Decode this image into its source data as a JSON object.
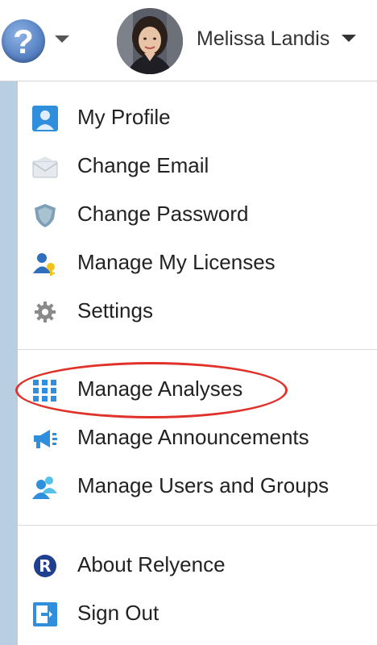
{
  "header": {
    "help_icon": "help-question-icon",
    "help_symbol": "?",
    "user_name": "Melissa Landis"
  },
  "menu": {
    "items": [
      {
        "label": "My Profile",
        "icon": "profile-icon"
      },
      {
        "label": "Change Email",
        "icon": "envelope-icon"
      },
      {
        "label": "Change Password",
        "icon": "shield-icon"
      },
      {
        "label": "Manage My Licenses",
        "icon": "user-key-icon"
      },
      {
        "label": "Settings",
        "icon": "gear-icon"
      },
      {
        "label": "Manage Analyses",
        "icon": "grid-icon"
      },
      {
        "label": "Manage Announcements",
        "icon": "megaphone-icon"
      },
      {
        "label": "Manage Users and Groups",
        "icon": "users-icon"
      },
      {
        "label": "About Relyence",
        "icon": "relyence-logo-icon"
      },
      {
        "label": "Sign Out",
        "icon": "sign-out-icon"
      }
    ]
  },
  "colors": {
    "accent_blue": "#2f8fdd",
    "highlight_red": "#e0322a",
    "side_strip": "#b9cee1"
  }
}
